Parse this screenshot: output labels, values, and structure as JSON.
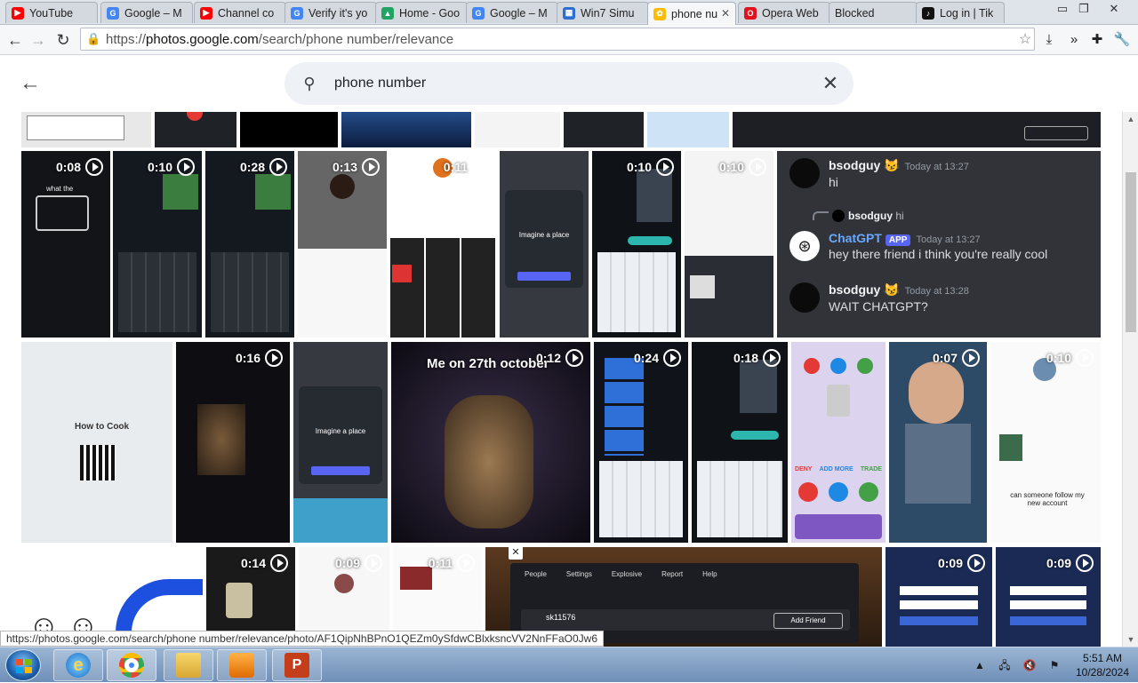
{
  "browser": {
    "tabs": [
      {
        "label": "YouTube",
        "icon": "youtube-icon",
        "color": "#ff0000"
      },
      {
        "label": "Google – M",
        "icon": "google-icon",
        "color": "#4285f4"
      },
      {
        "label": "Channel co",
        "icon": "youtube-icon",
        "color": "#ff0000"
      },
      {
        "label": "Verify it's yo",
        "icon": "google-icon",
        "color": "#4285f4"
      },
      {
        "label": "Home - Goo",
        "icon": "drive-icon",
        "color": "#1fa463"
      },
      {
        "label": "Google – M",
        "icon": "google-icon",
        "color": "#4285f4"
      },
      {
        "label": "Win7 Simu",
        "icon": "window-icon",
        "color": "#2a6fd1"
      },
      {
        "label": "phone nu",
        "icon": "photos-icon",
        "color": "#fbbc04",
        "active": true
      },
      {
        "label": "Opera Web",
        "icon": "opera-icon",
        "color": "#e0121d"
      },
      {
        "label": "Blocked",
        "icon": "blank-icon",
        "color": "#999999"
      },
      {
        "label": "Log in | Tik",
        "icon": "tiktok-icon",
        "color": "#111111"
      }
    ],
    "url_prefix": "https://",
    "url_host": "photos.google.com",
    "url_path": "/search/phone number/relevance",
    "status_link": "https://photos.google.com/search/phone number/relevance/photo/AF1QipNhBPnO1QEZm0ySfdwCBlxksncVV2NnFFaO0Jw6"
  },
  "photos": {
    "search_query": "phone number",
    "thumbs": [
      {
        "duration": "0:08"
      },
      {
        "duration": "0:10"
      },
      {
        "duration": "0:28"
      },
      {
        "duration": "0:13"
      },
      {
        "duration": "0:11"
      },
      {
        "duration": "0:10"
      },
      {
        "duration": "0:16"
      },
      {
        "duration": "0:12"
      },
      {
        "duration": "0:24"
      },
      {
        "duration": "0:18"
      },
      {
        "duration": "0:07"
      },
      {
        "duration": "0:10"
      },
      {
        "duration": "0:14"
      },
      {
        "duration": "0:09"
      },
      {
        "duration": "0:11"
      },
      {
        "duration": "0:09"
      },
      {
        "duration": "0:09"
      }
    ],
    "captions": {
      "phone_hint": "what the",
      "tiktok_caption": "Me on 27th october",
      "follow_text": "can someone follow my new account",
      "fnaf_buttons": [
        "DENY",
        "ADD MORE",
        "TRADE"
      ],
      "qr_text": "How to Cook",
      "discord_prompt": "Imagine a place",
      "lobby_user": "sk11576",
      "lobby_tabs": [
        "People",
        "Settings",
        "Explosive",
        "Report",
        "Help"
      ],
      "add_friend": "Add Friend"
    },
    "chat": {
      "messages": [
        {
          "name": "bsodguy",
          "time": "Today at 13:27",
          "text": "hi"
        },
        {
          "reply_name": "bsodguy",
          "reply_text": "hi"
        },
        {
          "name": "ChatGPT",
          "tag": "APP",
          "time": "Today at 13:27",
          "text": "hey there friend i think you're really cool"
        },
        {
          "name": "bsodguy",
          "time": "Today at 13:28",
          "text": "WAIT CHATGPT?"
        }
      ]
    }
  },
  "taskbar": {
    "time": "5:51 AM",
    "date": "10/28/2024",
    "apps": [
      "internet-explorer-icon",
      "chrome-icon",
      "file-explorer-icon",
      "media-player-icon",
      "powerpoint-icon"
    ]
  }
}
